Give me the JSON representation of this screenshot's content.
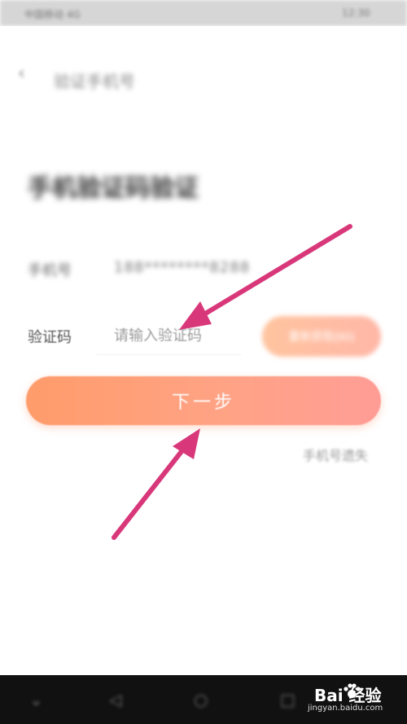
{
  "status_bar": {
    "left_text": "中国移动 4G",
    "right_text": "12:30"
  },
  "header": {
    "back_icon": "chevron-left-icon",
    "title": "验证手机号"
  },
  "page_title": "手机验证码验证",
  "phone_row": {
    "label": "手机号",
    "value": "188********8288"
  },
  "code_row": {
    "label": "验证码",
    "placeholder": "请输入验证码",
    "get_code_label": "重新获取(60)"
  },
  "next_button": {
    "label": "下一步"
  },
  "extra_link": "手机号遗失",
  "nav_bar": {
    "icons": [
      "collapse-icon",
      "back-icon",
      "home-icon",
      "recent-apps-icon"
    ]
  },
  "watermark": {
    "brand": "Bai 经验",
    "url": "jingyan.baidu.com"
  },
  "colors": {
    "accent_start": "#ff9c6b",
    "accent_end": "#ff9d96",
    "annotation_arrow": "#d8387a"
  }
}
